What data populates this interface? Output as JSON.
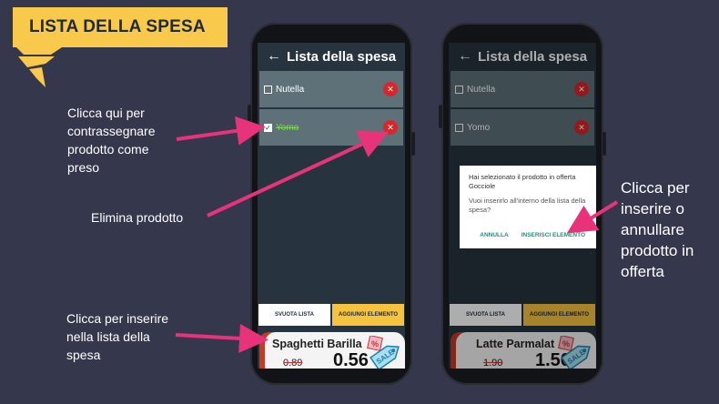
{
  "banner": {
    "title": "LISTA DELLA SPESA"
  },
  "notes": {
    "check": "Clicca qui per contrassegnare prodotto come preso",
    "delete": "Elimina prodotto",
    "add_offer": "Clicca per inserire nella lista della spesa",
    "confirm_offer": "Clicca per inserire o annullare prodotto in offerta"
  },
  "phone1": {
    "title": "Lista della spesa",
    "items": [
      {
        "label": "Nutella",
        "checked": false
      },
      {
        "label": "Yomo",
        "checked": true
      }
    ],
    "clear_label": "SVUOTA LISTA",
    "add_label": "AGGIUNGI ELEMENTO",
    "offer": {
      "name": "Spaghetti Barilla",
      "old_price": "0.89",
      "new_price": "0.56"
    }
  },
  "phone2": {
    "title": "Lista della spesa",
    "items": [
      {
        "label": "Nutella",
        "checked": false
      },
      {
        "label": "Yomo",
        "checked": false
      }
    ],
    "clear_label": "SVUOTA LISTA",
    "add_label": "AGGIUNGI ELEMENTO",
    "offer": {
      "name": "Latte Parmalat",
      "old_price": "1.90",
      "new_price": "1.50"
    },
    "dialog": {
      "message": "Hai selezionato il prodotto in offerta Gocciole",
      "question": "Vuoi inserirlo all'interno della lista della spesa?",
      "cancel": "ANNULLA",
      "confirm": "INSERISCI ELEMENTO"
    }
  },
  "icons": {
    "back": "back-arrow-icon",
    "delete": "close-icon",
    "check": "check-icon",
    "sale": "sale-tag-icon"
  },
  "colors": {
    "background": "#35384d",
    "banner": "#f8c94a",
    "arrow": "#e8337a",
    "delete": "#d9262b",
    "item": "#5e7178",
    "accent": "#f6c33f",
    "dialog_button": "#1e8f80"
  }
}
